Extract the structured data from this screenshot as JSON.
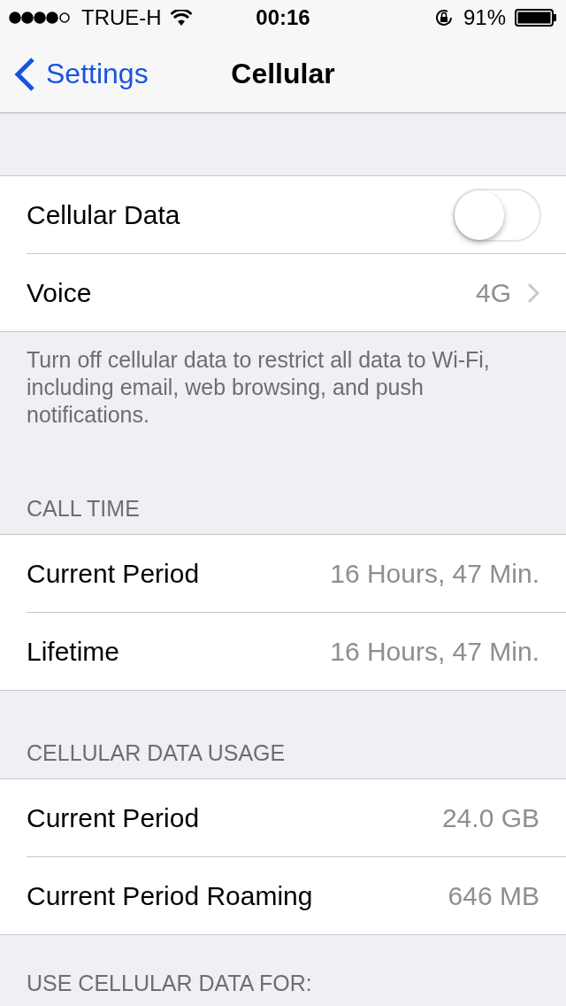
{
  "status_bar": {
    "carrier": "TRUE-H",
    "time": "00:16",
    "battery": "91%"
  },
  "nav": {
    "back": "Settings",
    "title": "Cellular"
  },
  "sections": [
    {
      "rows": [
        {
          "kind": "toggle",
          "label": "Cellular Data",
          "on": false
        },
        {
          "kind": "detail",
          "label": "Voice",
          "value": "4G"
        }
      ],
      "footer": "Turn off cellular data to restrict all data to Wi-Fi, including email, web browsing, and push notifications."
    },
    {
      "header": "CALL TIME",
      "rows": [
        {
          "kind": "value",
          "label": "Current Period",
          "value": "16 Hours, 47 Min."
        },
        {
          "kind": "value",
          "label": "Lifetime",
          "value": "16 Hours, 47 Min."
        }
      ]
    },
    {
      "header": "CELLULAR DATA USAGE",
      "rows": [
        {
          "kind": "value",
          "label": "Current Period",
          "value": "24.0 GB"
        },
        {
          "kind": "value",
          "label": "Current Period Roaming",
          "value": "646 MB"
        }
      ]
    },
    {
      "header": "USE CELLULAR DATA FOR:"
    }
  ]
}
